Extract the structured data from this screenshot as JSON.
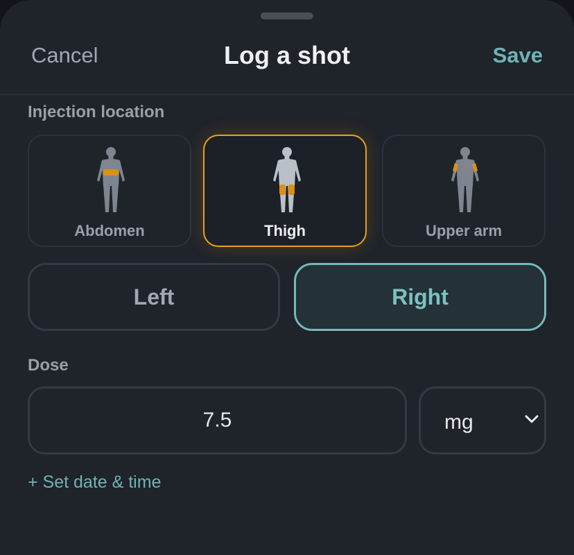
{
  "header": {
    "cancel_label": "Cancel",
    "title": "Log a shot",
    "save_label": "Save"
  },
  "location": {
    "label": "Injection location",
    "options": [
      {
        "label": "Abdomen",
        "icon": "abdomen-body-icon",
        "selected": false
      },
      {
        "label": "Thigh",
        "icon": "thigh-body-icon",
        "selected": true
      },
      {
        "label": "Upper arm",
        "icon": "upper-arm-body-icon",
        "selected": false
      }
    ]
  },
  "side": {
    "options": [
      {
        "label": "Left",
        "selected": false
      },
      {
        "label": "Right",
        "selected": true
      }
    ]
  },
  "dose": {
    "label": "Dose",
    "value": "7.5",
    "unit": "mg"
  },
  "set_date_label": "+ Set date & time",
  "colors": {
    "accent": "#6fb3b5",
    "highlight": "#e9a01c",
    "background": "#1f232a"
  }
}
